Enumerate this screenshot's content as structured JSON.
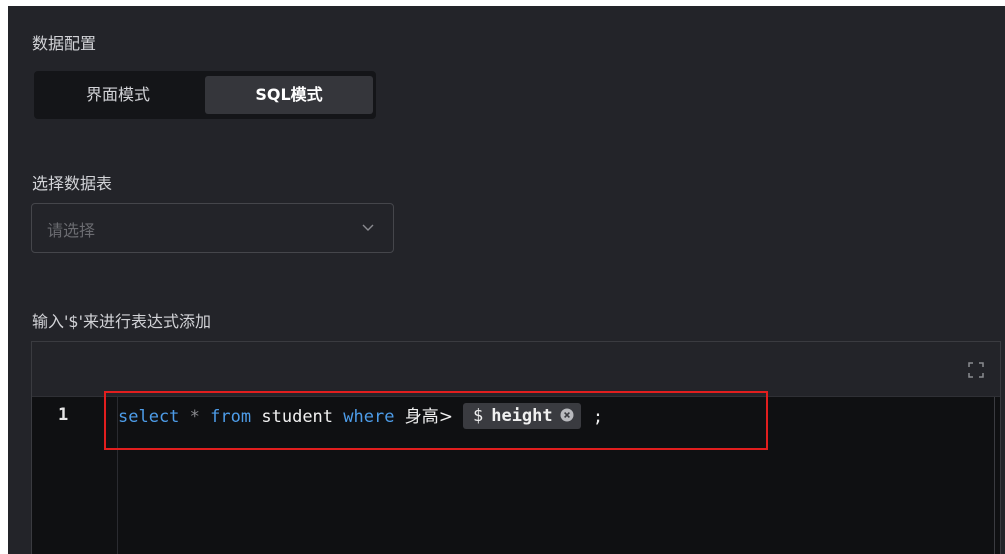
{
  "data_config": {
    "title": "数据配置",
    "modes": {
      "ui_label": "界面模式",
      "sql_label": "SQL模式",
      "active": "SQL模式"
    }
  },
  "table_select": {
    "title": "选择数据表",
    "placeholder": "请选择"
  },
  "expression_editor": {
    "title": "输入'$'来进行表达式添加",
    "line_number": "1",
    "code": {
      "kw_select": "select",
      "star": "*",
      "kw_from": "from",
      "table_name": "student",
      "kw_where": "where",
      "field": "身高>",
      "expression_dollar": "$",
      "expression_name": "height",
      "terminator": ";"
    }
  },
  "colors": {
    "panel_bg": "#232429",
    "keyword": "#4d9ce8",
    "highlight_border": "#e11e1e"
  },
  "icons": {
    "select_arrow": "chevron-down-icon",
    "fullscreen": "fullscreen-icon",
    "tag_remove": "close-circle-icon"
  }
}
